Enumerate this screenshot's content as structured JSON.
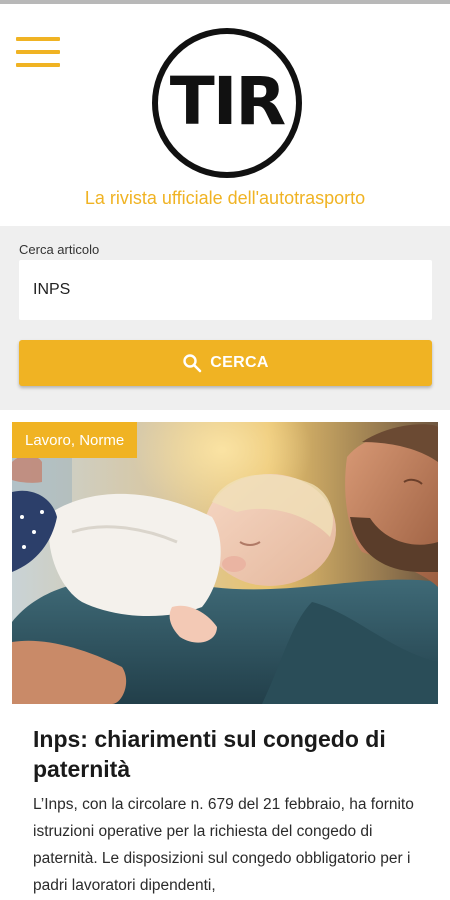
{
  "header": {
    "menu_icon": "hamburger-menu-icon",
    "logo_text": "TIR",
    "tagline": "La rivista ufficiale dell'autotrasporto"
  },
  "search": {
    "label": "Cerca articolo",
    "value": "INPS",
    "button_label": "CERCA",
    "button_icon": "search-icon"
  },
  "article": {
    "category": "Lavoro, Norme",
    "title": "Inps: chiarimenti sul congedo di paternità",
    "excerpt": "L’Inps, con la circolare n. 679 del 21 febbraio, ha fornito istruzioni operative per la richiesta del congedo di paternità. Le disposizioni sul congedo obbligatorio per i padri lavoratori dipendenti,"
  },
  "colors": {
    "accent": "#f0b323",
    "panel_bg": "#efefef",
    "logo": "#111111"
  }
}
